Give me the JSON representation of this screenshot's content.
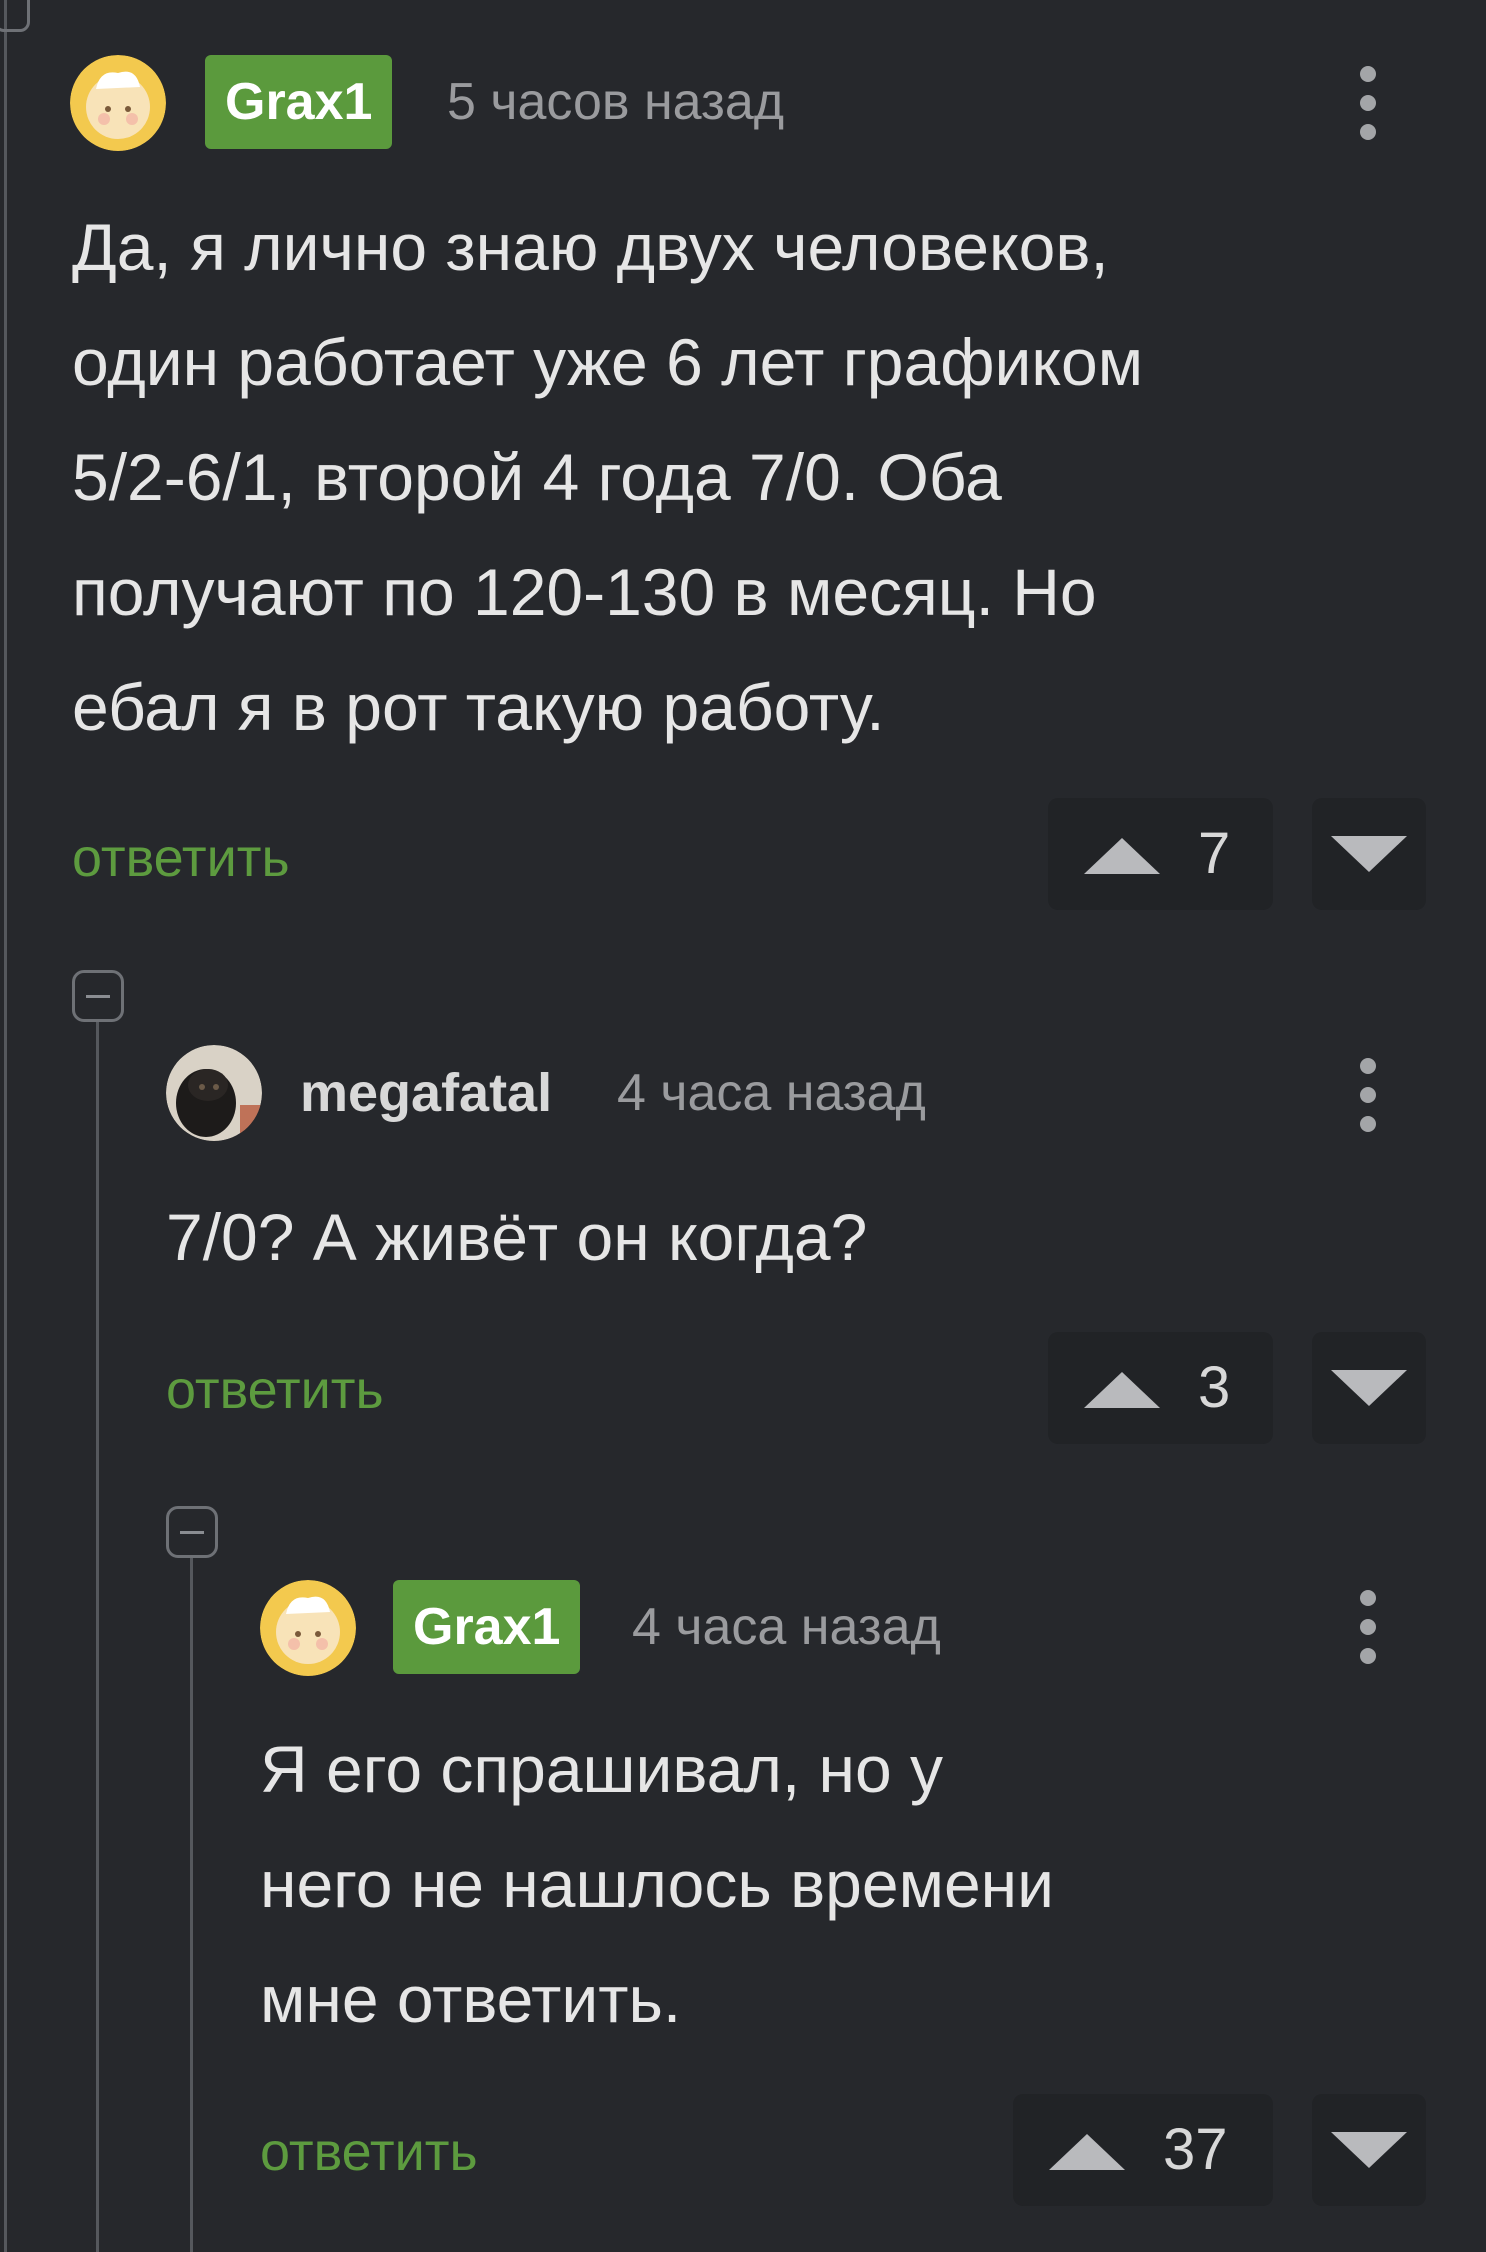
{
  "comments": [
    {
      "author": "Grax1",
      "author_badge": true,
      "time": "5 часов назад",
      "text": "Да, я лично знаю двух человеков,\nодин работает уже 6 лет графиком\n5/2-6/1, второй 4 года 7/0. Оба\nполучают по 120-130 в месяц. Но\nебал я в рот такую работу.",
      "reply_label": "ответить",
      "upvotes": "7"
    },
    {
      "author": "megafatal",
      "author_badge": false,
      "time": "4 часа назад",
      "text": "7/0? А живёт он когда?",
      "reply_label": "ответить",
      "upvotes": "3"
    },
    {
      "author": "Grax1",
      "author_badge": true,
      "time": "4 часа назад",
      "text": "Я его спрашивал, но у\nнего не нашлось времени\nмне ответить.",
      "reply_label": "ответить",
      "upvotes": "37"
    }
  ],
  "colors": {
    "background": "#26282c",
    "accent_green": "#5b9a3d",
    "reply_link": "#5d9b3f",
    "thread_line": "#55585d"
  },
  "icons": {
    "more": "vertical-dots-icon",
    "upvote": "triangle-up-icon",
    "downvote": "triangle-down-icon",
    "collapse": "collapse-minus-icon"
  }
}
